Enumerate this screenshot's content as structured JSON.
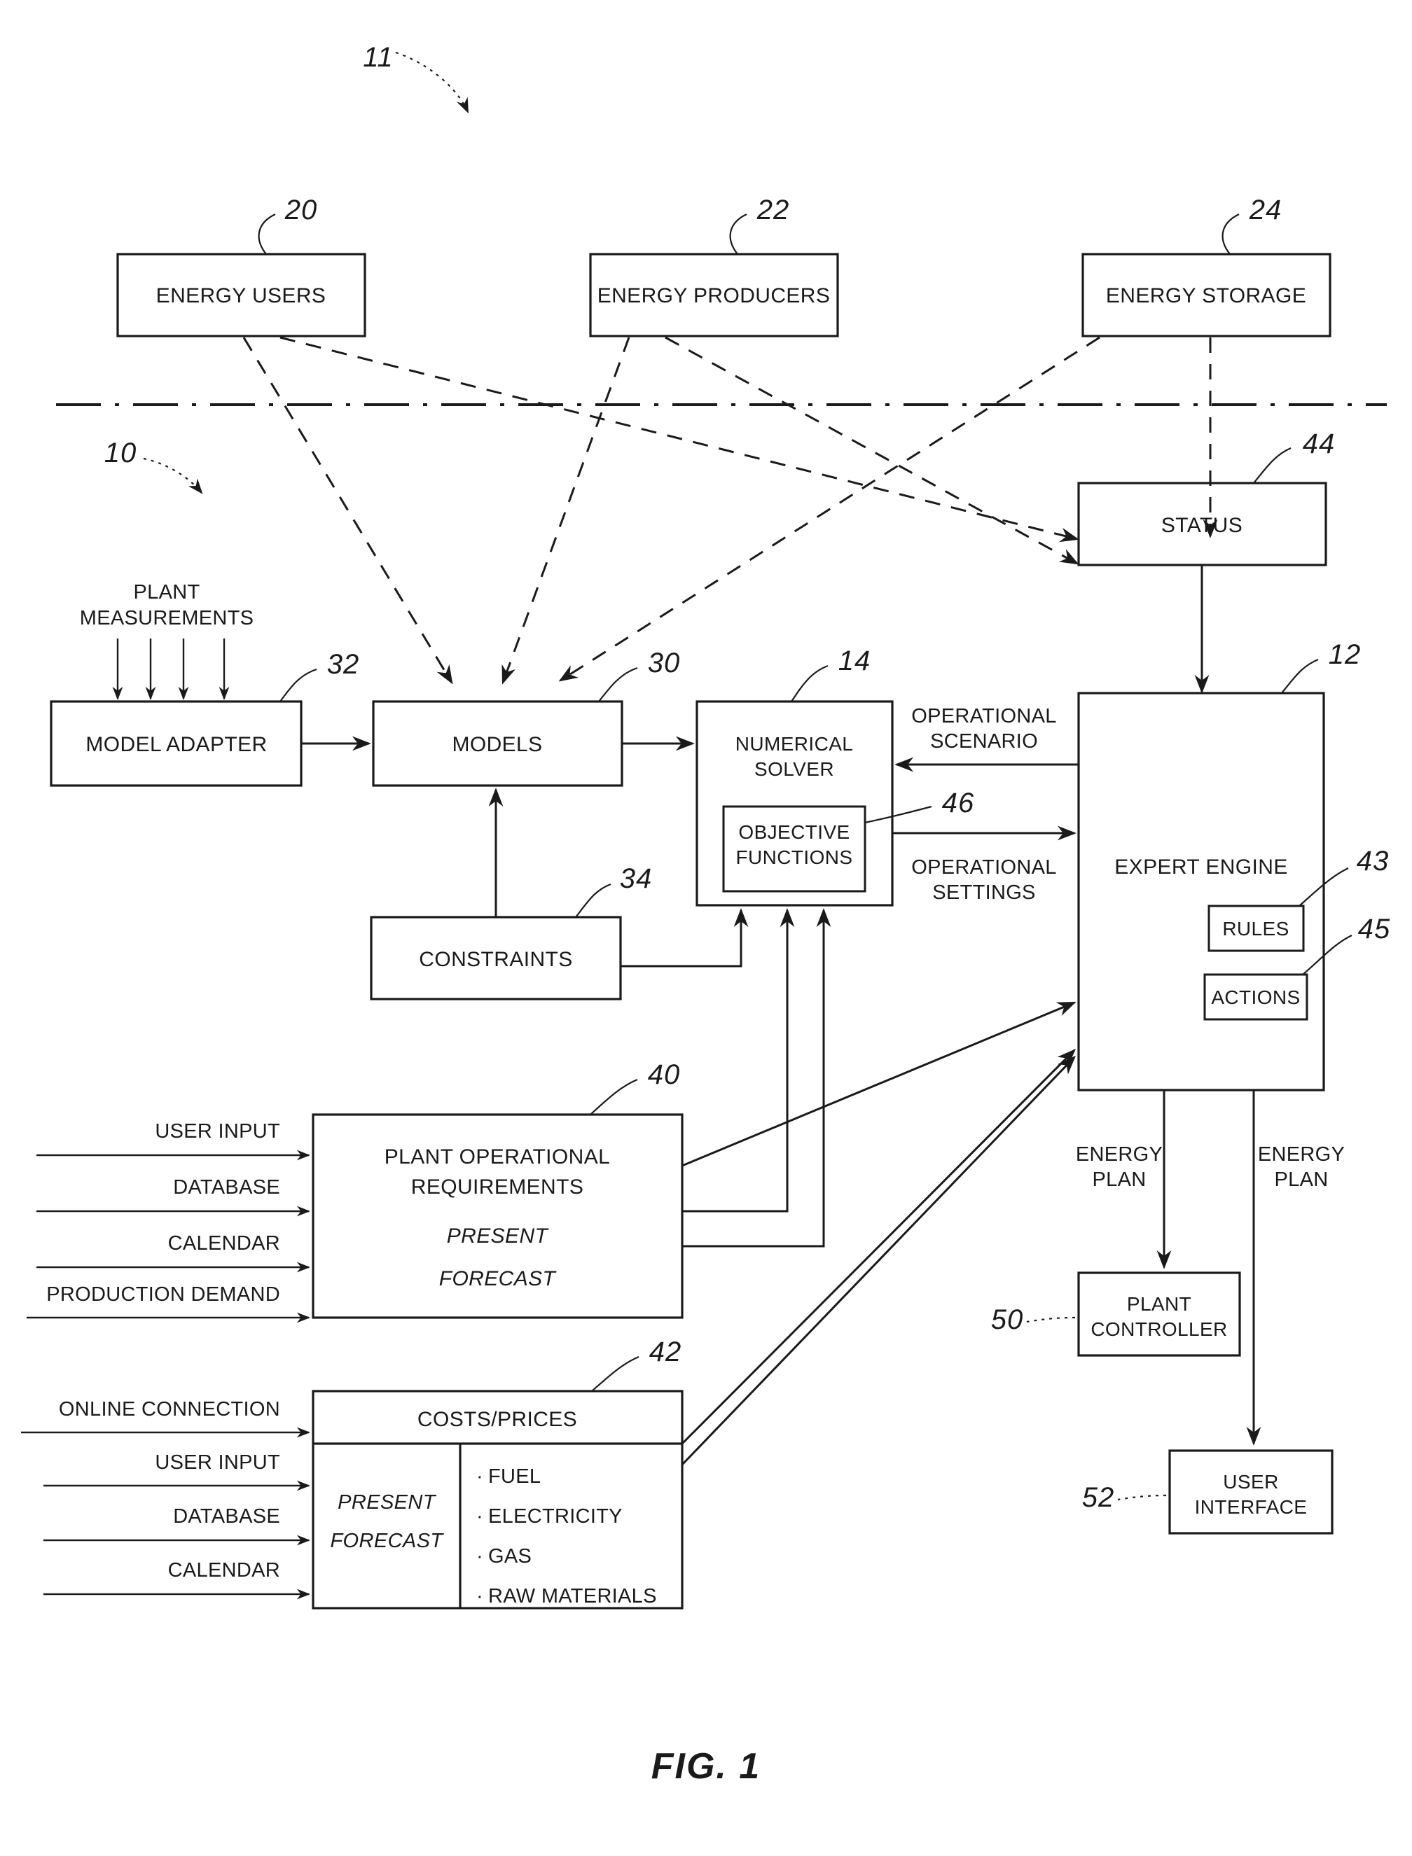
{
  "figure": {
    "caption": "FIG. 1",
    "system_label": "11",
    "subsystem_label": "10"
  },
  "boxes": {
    "energy_users": {
      "label": "ENERGY USERS",
      "ref": "20"
    },
    "energy_producers": {
      "label": "ENERGY PRODUCERS",
      "ref": "22"
    },
    "energy_storage": {
      "label": "ENERGY STORAGE",
      "ref": "24"
    },
    "status": {
      "label": "STATUS",
      "ref": "44"
    },
    "model_adapter": {
      "label": "MODEL ADAPTER",
      "ref": "32"
    },
    "models": {
      "label": "MODELS",
      "ref": "30"
    },
    "numerical_solver": {
      "label_line1": "NUMERICAL",
      "label_line2": "SOLVER",
      "ref": "14"
    },
    "objective_functions": {
      "label_line1": "OBJECTIVE",
      "label_line2": "FUNCTIONS",
      "ref": "46"
    },
    "expert_engine": {
      "label": "EXPERT ENGINE",
      "ref": "12"
    },
    "rules": {
      "label": "RULES",
      "ref": "43"
    },
    "actions": {
      "label": "ACTIONS",
      "ref": "45"
    },
    "constraints": {
      "label": "CONSTRAINTS",
      "ref": "34"
    },
    "plant_operational_requirements": {
      "label_line1": "PLANT OPERATIONAL",
      "label_line2": "REQUIREMENTS",
      "italic_line1": "PRESENT",
      "italic_line2": "FORECAST",
      "ref": "40"
    },
    "costs_prices": {
      "label": "COSTS/PRICES",
      "italic_line1": "PRESENT",
      "italic_line2": "FORECAST",
      "items": [
        "FUEL",
        "ELECTRICITY",
        "GAS",
        "RAW MATERIALS"
      ],
      "ref": "42"
    },
    "plant_controller": {
      "label_line1": "PLANT",
      "label_line2": "CONTROLLER",
      "ref": "50"
    },
    "user_interface": {
      "label_line1": "USER",
      "label_line2": "INTERFACE",
      "ref": "52"
    }
  },
  "edge_labels": {
    "plant_measurements_line1": "PLANT",
    "plant_measurements_line2": "MEASUREMENTS",
    "operational_scenario_line1": "OPERATIONAL",
    "operational_scenario_line2": "SCENARIO",
    "operational_settings_line1": "OPERATIONAL",
    "operational_settings_line2": "SETTINGS",
    "energy_plan_a_line1": "ENERGY",
    "energy_plan_a_line2": "PLAN",
    "energy_plan_b_line1": "ENERGY",
    "energy_plan_b_line2": "PLAN"
  },
  "inputs_requirements": [
    "USER INPUT",
    "DATABASE",
    "CALENDAR",
    "PRODUCTION DEMAND"
  ],
  "inputs_costs": [
    "ONLINE CONNECTION",
    "USER INPUT",
    "DATABASE",
    "CALENDAR"
  ],
  "colors": {
    "ink": "#1a1a1a",
    "paper": "#ffffff"
  }
}
